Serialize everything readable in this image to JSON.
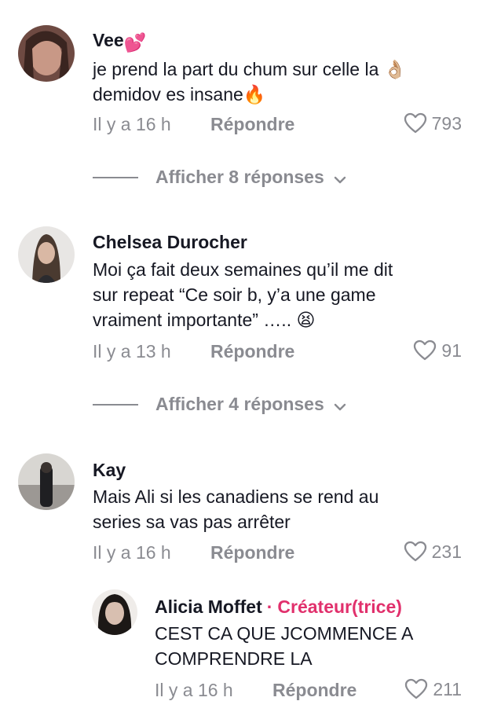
{
  "comments": [
    {
      "username": "Vee",
      "name_emoji": "💕",
      "lines": [
        "je prend la part du chum sur celle la 👌🏼",
        "demidov es insane🔥"
      ],
      "time": "Il y a 16 h",
      "reply_label": "Répondre",
      "likes": "793",
      "view_replies": "Afficher 8 réponses"
    },
    {
      "username": "Chelsea Durocher",
      "lines": [
        "Moi ça fait deux semaines qu’il me dit",
        "sur repeat “Ce soir b, y’a une game",
        "vraiment importante” ….. 😫"
      ],
      "time": "Il y a 13 h",
      "reply_label": "Répondre",
      "likes": "91",
      "view_replies": "Afficher 4 réponses"
    },
    {
      "username": "Kay",
      "lines": [
        "Mais Ali si les canadiens se rend au",
        "series sa vas pas arrêter"
      ],
      "time": "Il y a 16 h",
      "reply_label": "Répondre",
      "likes": "231"
    }
  ],
  "reply": {
    "username": "Alicia Moffet",
    "separator": "·",
    "creator_label": "Créateur(trice)",
    "lines": [
      "CEST CA QUE JCOMMENCE A",
      "COMPRENDRE LA"
    ],
    "time": "Il y a 16 h",
    "reply_label": "Répondre",
    "likes": "211"
  },
  "colors": {
    "muted": "#8a8b91",
    "text": "#161823",
    "creator": "#e1306c"
  },
  "icons": {
    "like": "heart-outline-icon",
    "expand": "chevron-down-icon"
  }
}
